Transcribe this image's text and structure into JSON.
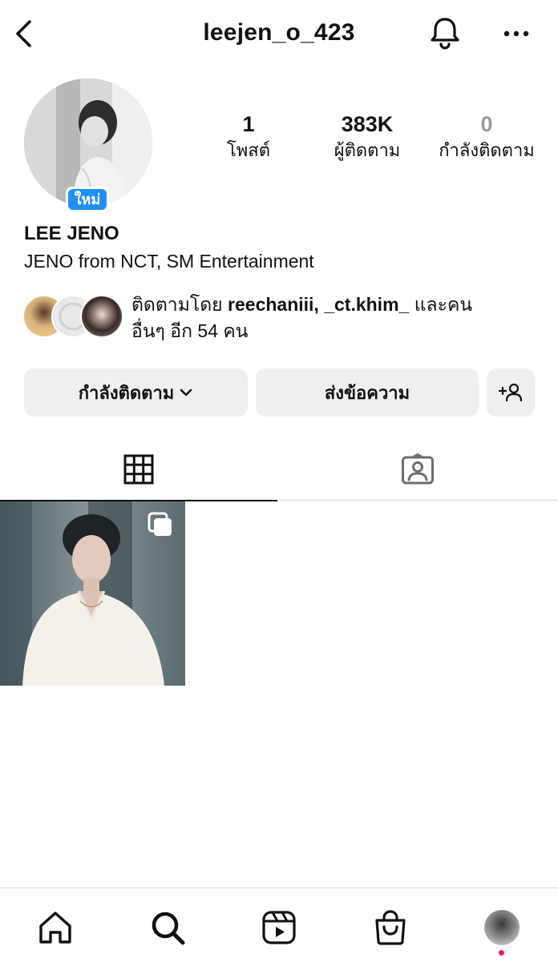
{
  "header": {
    "username": "leejen_o_423"
  },
  "profile": {
    "badge": "ใหม่",
    "display_name": "LEE JENO",
    "bio": "JENO from NCT, SM Entertainment"
  },
  "stats": [
    {
      "value": "1",
      "label": "โพสต์"
    },
    {
      "value": "383K",
      "label": "ผู้ติดตาม"
    },
    {
      "value": "0",
      "label": "กำลังติดตาม"
    }
  ],
  "mutual": {
    "prefix": "ติดตามโดย ",
    "users": "reechaniii, _ct.khim_",
    "suffix": " และคน",
    "line2": "อื่นๆ อีก 54 คน"
  },
  "actions": {
    "following_label": "กำลังติดตาม",
    "message_label": "ส่งข้อความ"
  },
  "icons": {
    "back": "chevron-left-icon",
    "bell": "bell-icon",
    "more": "more-horizontal-icon",
    "add_person": "add-person-icon",
    "grid": "grid-icon",
    "tagged": "tagged-person-icon",
    "multi_post": "multiple-photos-icon",
    "home": "home-icon",
    "search": "search-icon",
    "reels": "reels-icon",
    "shop": "shop-bag-icon"
  },
  "colors": {
    "badge": "#1e90f5",
    "notification_dot": "#ed1c4b",
    "button_bg": "#efefef"
  }
}
